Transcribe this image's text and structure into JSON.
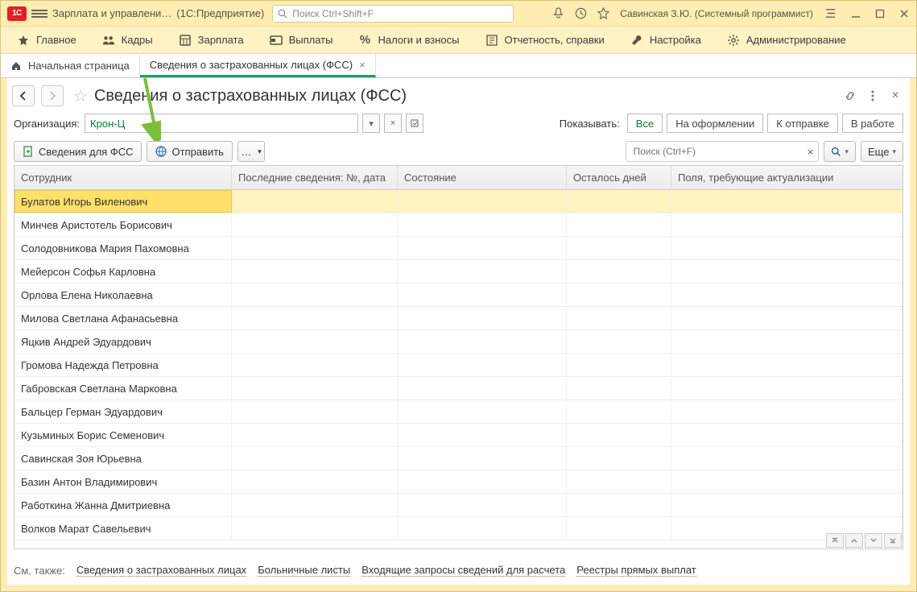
{
  "titlebar": {
    "app_title_1": "Зарплата и управлени…",
    "app_title_2": "(1С:Предприятие)",
    "search_placeholder": "Поиск Ctrl+Shift+F",
    "user": "Савинская З.Ю. (Системный программист)"
  },
  "mainnav": {
    "items": [
      {
        "label": "Главное",
        "icon": "star"
      },
      {
        "label": "Кадры",
        "icon": "people"
      },
      {
        "label": "Зарплата",
        "icon": "calc"
      },
      {
        "label": "Выплаты",
        "icon": "wallet"
      },
      {
        "label": "Налоги и взносы",
        "icon": "percent"
      },
      {
        "label": "Отчетность, справки",
        "icon": "report"
      },
      {
        "label": "Настройка",
        "icon": "wrench"
      },
      {
        "label": "Администрирование",
        "icon": "gear"
      }
    ]
  },
  "tabs": {
    "home": "Начальная страница",
    "current": "Сведения о застрахованных лицах (ФСС)"
  },
  "page": {
    "title": "Сведения о застрахованных лицах (ФСС)",
    "org_label": "Организация:",
    "org_value": "Крон-Ц",
    "show_label": "Показывать:",
    "filters": [
      "Все",
      "На оформлении",
      "К отправке",
      "В работе"
    ],
    "btn_fss": "Сведения для ФСС",
    "btn_send": "Отправить",
    "search_placeholder": "Поиск (Ctrl+F)",
    "btn_more": "Еще"
  },
  "table": {
    "columns": [
      "Сотрудник",
      "Последние сведения: №, дата",
      "Состояние",
      "Осталось дней",
      "Поля, требующие актуализации"
    ],
    "rows": [
      {
        "name": "Булатов Игорь Виленович",
        "last": "",
        "status": "",
        "days": "",
        "fields": "",
        "selected": true
      },
      {
        "name": "Минчев Аристотель Борисович"
      },
      {
        "name": "Солодовникова Мария Пахомовна"
      },
      {
        "name": "Мейерсон Софья Карловна"
      },
      {
        "name": "Орлова Елена Николаевна"
      },
      {
        "name": "Милова Светлана Афанасьевна"
      },
      {
        "name": "Яцкив Андрей Эдуардович"
      },
      {
        "name": "Громова Надежда Петровна"
      },
      {
        "name": "Габровская Светлана Марковна"
      },
      {
        "name": "Бальцер Герман Эдуардович"
      },
      {
        "name": "Кузьминых Борис Семенович"
      },
      {
        "name": "Савинская Зоя Юрьевна"
      },
      {
        "name": "Базин Антон Владимирович"
      },
      {
        "name": "Работкина Жанна Дмитриевна"
      },
      {
        "name": "Волков Марат Савельевич"
      }
    ]
  },
  "footer": {
    "label": "См. также:",
    "links": [
      "Сведения о застрахованных лицах",
      "Больничные листы",
      "Входящие запросы сведений для расчета",
      "Реестры прямых выплат"
    ]
  }
}
